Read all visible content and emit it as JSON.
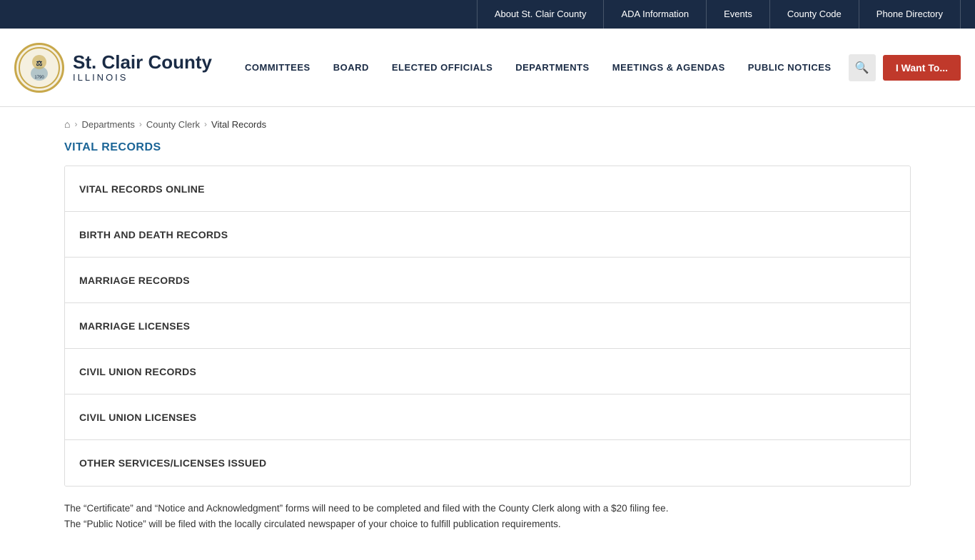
{
  "topbar": {
    "links": [
      {
        "label": "About St. Clair County",
        "id": "about"
      },
      {
        "label": "ADA Information",
        "id": "ada"
      },
      {
        "label": "Events",
        "id": "events"
      },
      {
        "label": "County Code",
        "id": "county-code"
      },
      {
        "label": "Phone Directory",
        "id": "phone-directory"
      }
    ]
  },
  "logo": {
    "county_name": "St. Clair County",
    "state_name": "ILLINOIS"
  },
  "nav": {
    "items": [
      {
        "label": "COMMITTEES",
        "id": "committees"
      },
      {
        "label": "BOARD",
        "id": "board"
      },
      {
        "label": "ELECTED OFFICIALS",
        "id": "elected-officials"
      },
      {
        "label": "DEPARTMENTS",
        "id": "departments"
      },
      {
        "label": "MEETINGS & AGENDAS",
        "id": "meetings"
      },
      {
        "label": "PUBLIC NOTICES",
        "id": "public-notices"
      }
    ],
    "iwant_label": "I Want To..."
  },
  "breadcrumb": {
    "home_label": "⌂",
    "items": [
      {
        "label": "Departments",
        "id": "departments"
      },
      {
        "label": "County Clerk",
        "id": "county-clerk"
      },
      {
        "label": "Vital Records",
        "id": "vital-records"
      }
    ]
  },
  "page": {
    "title": "VITAL RECORDS",
    "accordion_items": [
      {
        "label": "VITAL RECORDS ONLINE",
        "id": "vital-records-online"
      },
      {
        "label": "BIRTH AND DEATH RECORDS",
        "id": "birth-death"
      },
      {
        "label": "MARRIAGE RECORDS",
        "id": "marriage-records"
      },
      {
        "label": "MARRIAGE LICENSES",
        "id": "marriage-licenses"
      },
      {
        "label": "CIVIL UNION RECORDS",
        "id": "civil-union-records"
      },
      {
        "label": "CIVIL UNION LICENSES",
        "id": "civil-union-licenses"
      },
      {
        "label": "OTHER SERVICES/LICENSES ISSUED",
        "id": "other-services"
      }
    ],
    "footer_note_line1": "The “Certificate” and “Notice and Acknowledgment” forms will need to be completed and filed with the County Clerk along with a $20 filing fee.",
    "footer_note_line2": "The “Public Notice” will be filed with the locally circulated newspaper of your choice to fulfill publication requirements."
  }
}
